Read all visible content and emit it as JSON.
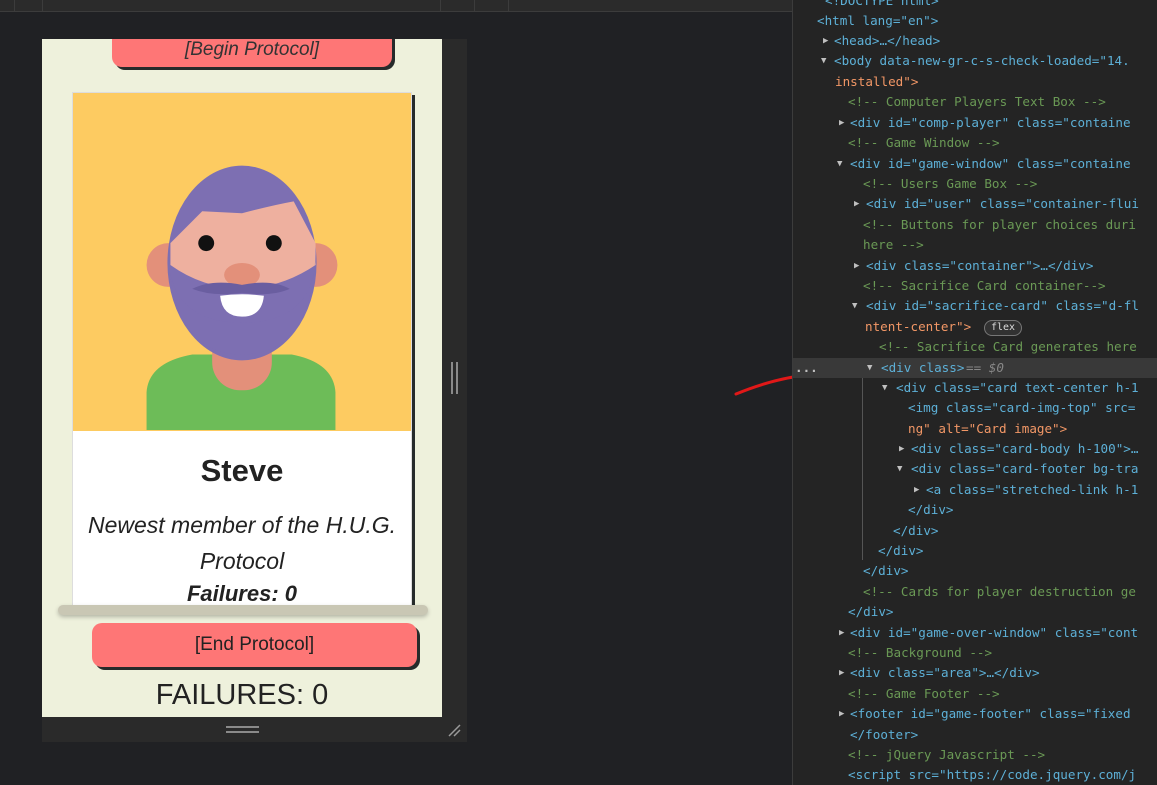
{
  "game": {
    "begin_button": "[Begin Protocol]",
    "card": {
      "img_alt": "Card image",
      "name": "Steve",
      "description": "Newest member of the H.U.G. Protocol",
      "failures_text": "Failures: 0"
    },
    "end_button": "[End Protocol]",
    "failures_total": "FAILURES: 0"
  },
  "colors": {
    "page_bg": "#eef1dc",
    "button_red": "#fe7676",
    "card_image_bg": "#fdcb61",
    "avatar_hair": "#7d6fb2",
    "avatar_skin": "#eeb09f",
    "avatar_shirt": "#6dbc58"
  },
  "devtools": {
    "lines": [
      {
        "id": "l0",
        "text": "<!DOCTYPE html>"
      },
      {
        "id": "l1",
        "text": "<html lang=\"en\">"
      },
      {
        "id": "l2",
        "text": "<head>…</head>"
      },
      {
        "id": "l3",
        "text": "<body data-new-gr-c-s-check-loaded=\"14."
      },
      {
        "id": "l4",
        "text": "installed\">"
      },
      {
        "id": "l5",
        "text": "<!-- Computer Players Text Box -->"
      },
      {
        "id": "l6",
        "text": "<div id=\"comp-player\" class=\"containe"
      },
      {
        "id": "l7",
        "text": "<!-- Game Window -->"
      },
      {
        "id": "l8",
        "text": "<div id=\"game-window\" class=\"containe"
      },
      {
        "id": "l9",
        "text": "<!-- Users Game Box -->"
      },
      {
        "id": "l10",
        "text": "<div id=\"user\" class=\"container-flui"
      },
      {
        "id": "l11",
        "text": "<!-- Buttons for player choices duri"
      },
      {
        "id": "l12",
        "text": "here -->"
      },
      {
        "id": "l13",
        "text": "<div class=\"container\">…</div>"
      },
      {
        "id": "l14",
        "text": "<!-- Sacrifice Card container-->"
      },
      {
        "id": "l15",
        "text": "<div id=\"sacrifice-card\" class=\"d-fl"
      },
      {
        "id": "l16",
        "text": "ntent-center\">"
      },
      {
        "id": "l17",
        "text": "<!-- Sacrifice Card generates here"
      },
      {
        "id": "l18",
        "text": "<div class>"
      },
      {
        "id": "l19",
        "text": "<div class=\"card text-center h-1"
      },
      {
        "id": "l20",
        "text": "<img class=\"card-img-top\" src="
      },
      {
        "id": "l21",
        "text": "ng\" alt=\"Card image\">"
      },
      {
        "id": "l22",
        "text": "<div class=\"card-body h-100\">…"
      },
      {
        "id": "l23",
        "text": "<div class=\"card-footer bg-tra"
      },
      {
        "id": "l24",
        "text": "<a class=\"stretched-link h-1"
      },
      {
        "id": "l25",
        "text": "</div>"
      },
      {
        "id": "l26",
        "text": "</div>"
      },
      {
        "id": "l27",
        "text": "</div>"
      },
      {
        "id": "l28",
        "text": "</div>"
      },
      {
        "id": "l29",
        "text": "<!-- Cards for player destruction ge"
      },
      {
        "id": "l30",
        "text": "</div>"
      },
      {
        "id": "l31",
        "text": "<div id=\"game-over-window\" class=\"cont"
      },
      {
        "id": "l32",
        "text": "<!-- Background -->"
      },
      {
        "id": "l33",
        "text": "<div class=\"area\">…</div>"
      },
      {
        "id": "l34",
        "text": "<!-- Game Footer -->"
      },
      {
        "id": "l35",
        "text": "<footer id=\"game-footer\" class=\"fixed"
      },
      {
        "id": "l36",
        "text": "</footer>"
      },
      {
        "id": "l37",
        "text": "<!-- jQuery Javascript -->"
      },
      {
        "id": "l38",
        "text": "<script src=\"https://code.jquery.com/j"
      }
    ],
    "flex_badge": "flex",
    "selected_marker": "== $0",
    "ellipsis": "..."
  }
}
